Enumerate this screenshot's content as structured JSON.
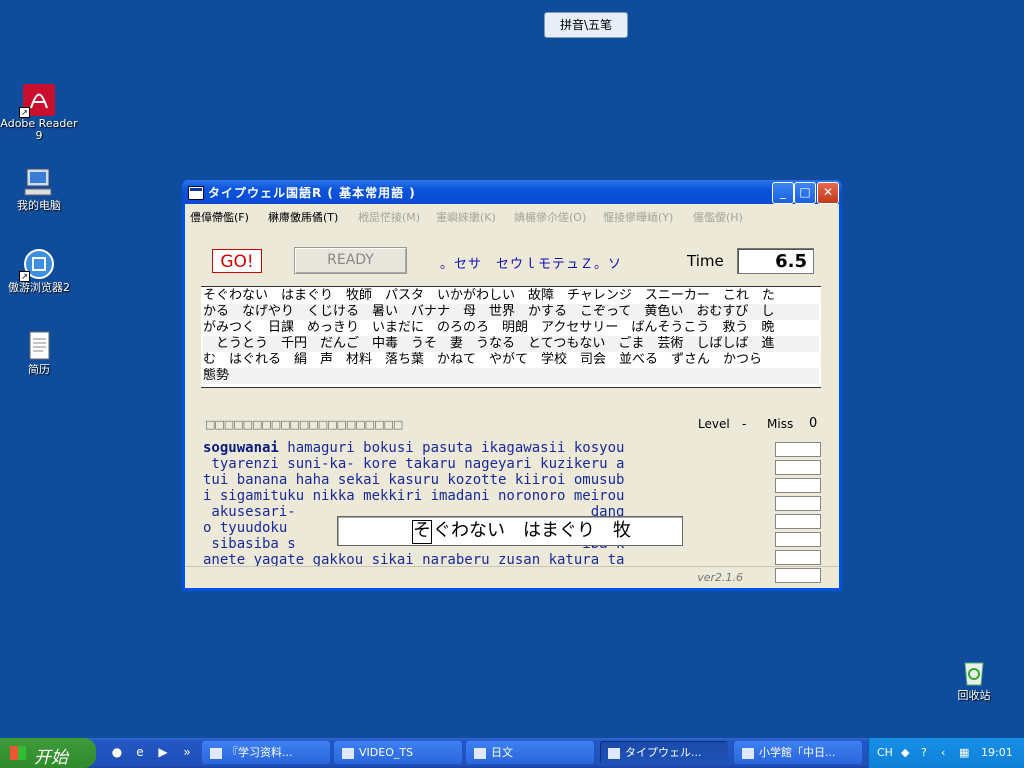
{
  "desktop": {
    "icons": [
      {
        "label": "Adobe Reader 9"
      },
      {
        "label": "我的电脑"
      },
      {
        "label": "傲游浏览器2"
      },
      {
        "label": "简历"
      },
      {
        "label": "回收站"
      }
    ],
    "ime_label": "拼音\\五笔"
  },
  "window": {
    "title": "タイプウェル国語R  ( 基本常用語 )",
    "controls": {
      "minimize": "_",
      "maximize": "□",
      "close": "✕"
    },
    "menu": [
      {
        "label": "僼傽僀儖(F)",
        "enabled": true
      },
      {
        "label": "楙廗儌乕僪(T)",
        "enabled": true
      },
      {
        "label": "栰巼恾掕(M)",
        "enabled": false
      },
      {
        "label": "寁嶼婡擻(K)",
        "enabled": false
      },
      {
        "label": "婰榐傪尒傞(O)",
        "enabled": false
      },
      {
        "label": "愝掕傪曄峏(Y)",
        "enabled": false
      },
      {
        "label": "僿儖僾(H)",
        "enabled": false
      }
    ],
    "go_label": "GO!",
    "ready_label": "READY",
    "mode_text": "。セサ　セウｌモテュＺ。ソ",
    "time_label": "Time",
    "time_value": "6.5",
    "text_lines": [
      "そぐわない　はまぐり　牧師　パスタ　いかがわしい　故障　チャレンジ　スニーカー　これ　た",
      "かる　なげやり　くじける　暑い　バナナ　母　世界　かする　こぞって　黄色い　おむすび　し",
      "がみつく　日課　めっきり　いまだに　のろのろ　明朗　アクセサリー　ばんそうこう　救う　晩",
      "　とうとう　千円　だんご　中毒　うそ　妻　うなる　とてつもない　ごま　芸術　しばしば　進",
      "む　はぐれる　絹　声　材料　落ち葉　かねて　やがて　学校　司会　並べる　ずさん　かつら",
      "態勢"
    ],
    "progress_squares": "□□□□□□□□□□□□□□□□□□□□□",
    "level_label": "Level",
    "level_value": "-",
    "miss_label": "Miss",
    "miss_value": "0",
    "romaji_first_word": "soguwanai",
    "romaji_lines": [
      " hamaguri bokusi pasuta ikagawasii kosyou",
      " tyarenzi suni-ka- kore takaru nageyari kuzikeru a",
      "tui banana haha sekai kasuru kozotte kiiroi omusub",
      "i sigamituku nikka mekkiri imadani noronoro meirou",
      " akusesari-                                   dang",
      "o tyuudoku                                   ijutu",
      " sibasiba s                                  iba k",
      "anete yagate gakkou sikai naraberu zusan katura ta"
    ],
    "input_cursor_char": "そ",
    "input_text": "ぐわない　はまぐり　牧",
    "version": "ver2.1.6"
  },
  "taskbar": {
    "start_label": "开始",
    "tasks": [
      {
        "label": "『学习资料..."
      },
      {
        "label": "VIDEO_TS"
      },
      {
        "label": "日文"
      },
      {
        "label": "タイプウェル..."
      },
      {
        "label": "小学館「中日..."
      }
    ],
    "tray": {
      "lang": "CH",
      "clock": "19:01"
    }
  }
}
